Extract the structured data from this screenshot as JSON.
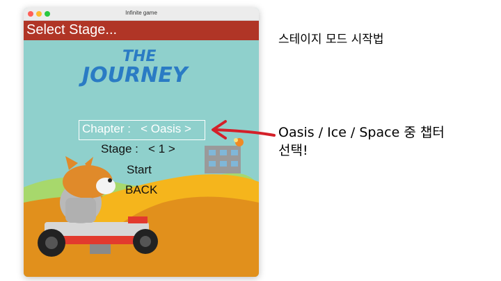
{
  "window": {
    "title": "Infinite game"
  },
  "banner": {
    "label": "Select Stage..."
  },
  "menu": {
    "chapter_label": "Chapter :",
    "chapter_value": "< Oasis >",
    "stage_label": "Stage :",
    "stage_value": "< 1 >",
    "start": "Start",
    "back": "BACK"
  },
  "logo": {
    "line1": "THE",
    "line2": "JOURNEY"
  },
  "annotations": {
    "title": "스테이지 모드 시작법",
    "note_line1": "Oasis / Ice / Space 중 챕터",
    "note_line2": "선택!"
  },
  "colors": {
    "banner": "#b03526",
    "sky": "#8fd0cc",
    "sand": "#e1901c",
    "road": "#f5b51c",
    "logo": "#2a7bc4",
    "arrow": "#d42029"
  }
}
